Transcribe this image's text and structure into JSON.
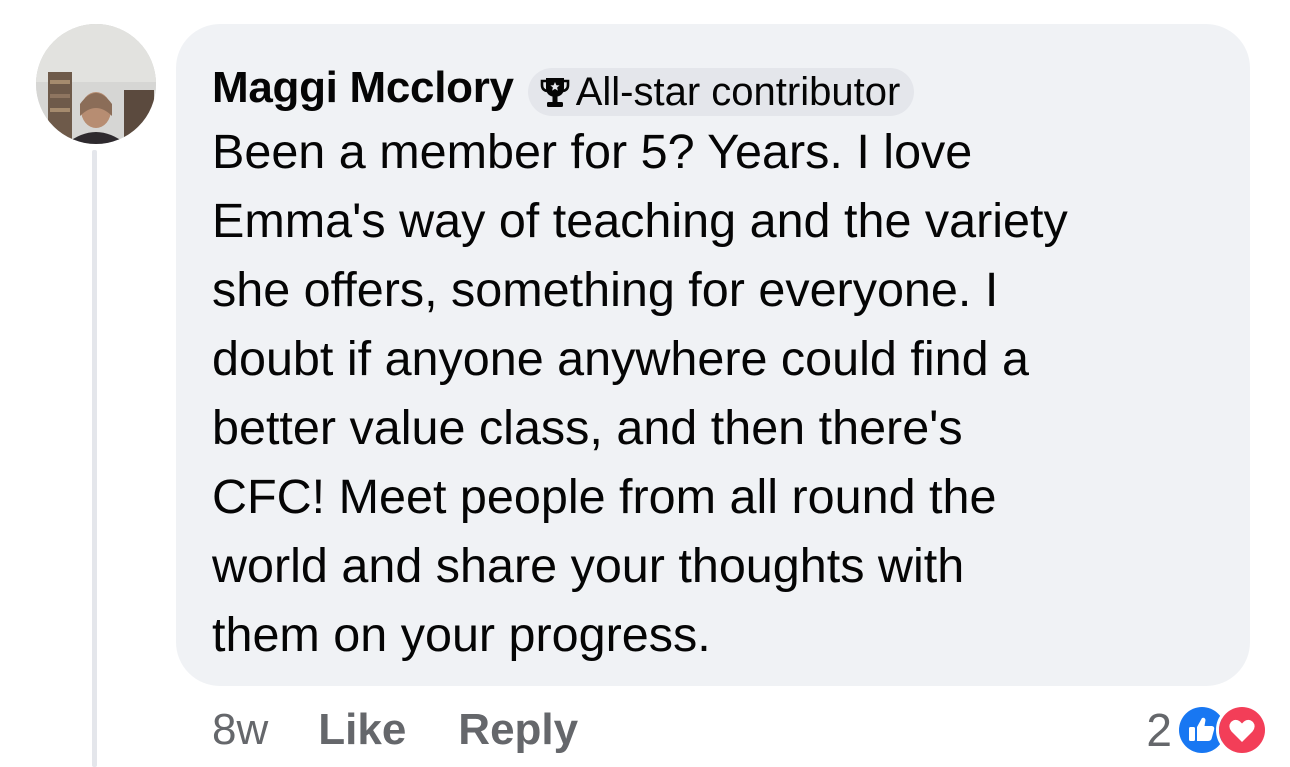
{
  "comment": {
    "author": "Maggi Mcclory",
    "badge": {
      "icon": "trophy-icon",
      "label": "All-star contributor"
    },
    "text": "Been a member for 5? Years. I love\nEmma's way of teaching and the variety\nshe offers, something for everyone. I\ndoubt if anyone anywhere could find a\nbetter value class, and then there's\nCFC! Meet people from all round the\nworld and share your thoughts with\nthem on your progress."
  },
  "actions": {
    "timestamp": "8w",
    "like_label": "Like",
    "reply_label": "Reply"
  },
  "reactions": {
    "count": "2",
    "icons": [
      "like-reaction-icon",
      "love-reaction-icon"
    ]
  },
  "colors": {
    "bubble": "#f0f2f5",
    "badge": "#e4e6eb",
    "text": "#050505",
    "secondary_text": "#65676b",
    "like_blue": "#1877f2",
    "love_red": "#f33e58"
  }
}
